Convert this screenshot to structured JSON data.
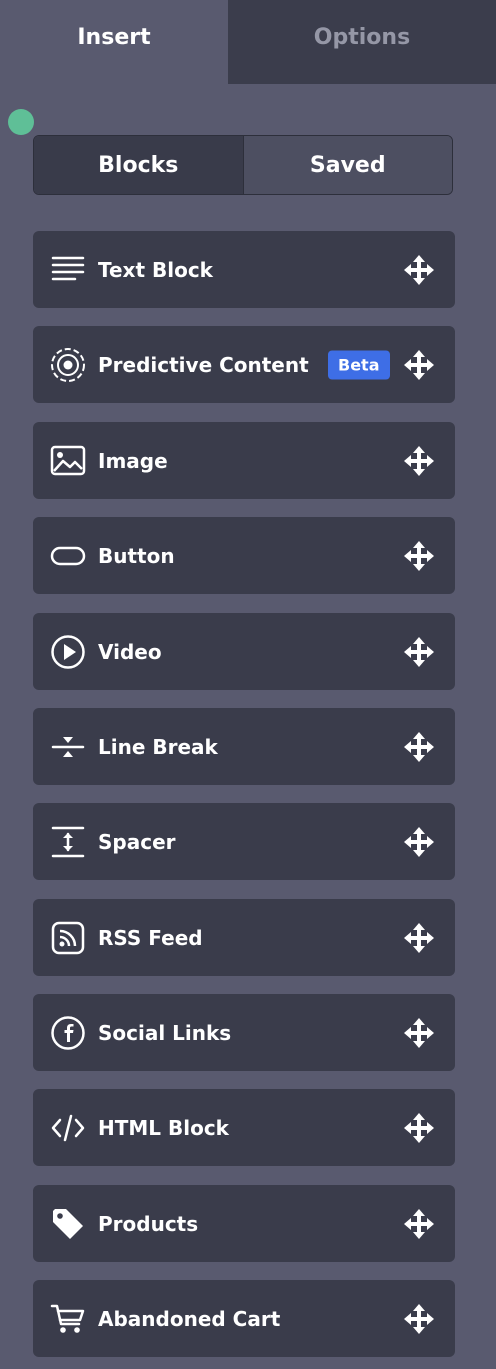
{
  "tabs": {
    "insert": "Insert",
    "options": "Options"
  },
  "segment": {
    "blocks": "Blocks",
    "saved": "Saved"
  },
  "colors": {
    "panel_bg": "#595a6f",
    "card_bg": "#3a3c4b",
    "inactive_tab_bg": "#3b3d4c",
    "status_dot": "#5fbf97",
    "beta_badge": "#3e6ee6"
  },
  "blocks": [
    {
      "label": "Text Block",
      "icon": "text-lines-icon"
    },
    {
      "label": "Predictive Content",
      "icon": "target-rings-icon",
      "badge": "Beta"
    },
    {
      "label": "Image",
      "icon": "image-icon"
    },
    {
      "label": "Button",
      "icon": "button-shape-icon"
    },
    {
      "label": "Video",
      "icon": "play-circle-icon"
    },
    {
      "label": "Line Break",
      "icon": "line-break-icon"
    },
    {
      "label": "Spacer",
      "icon": "spacer-icon"
    },
    {
      "label": "RSS Feed",
      "icon": "rss-icon"
    },
    {
      "label": "Social Links",
      "icon": "facebook-circle-icon"
    },
    {
      "label": "HTML Block",
      "icon": "code-icon"
    },
    {
      "label": "Products",
      "icon": "tag-icon"
    },
    {
      "label": "Abandoned Cart",
      "icon": "cart-icon"
    }
  ]
}
